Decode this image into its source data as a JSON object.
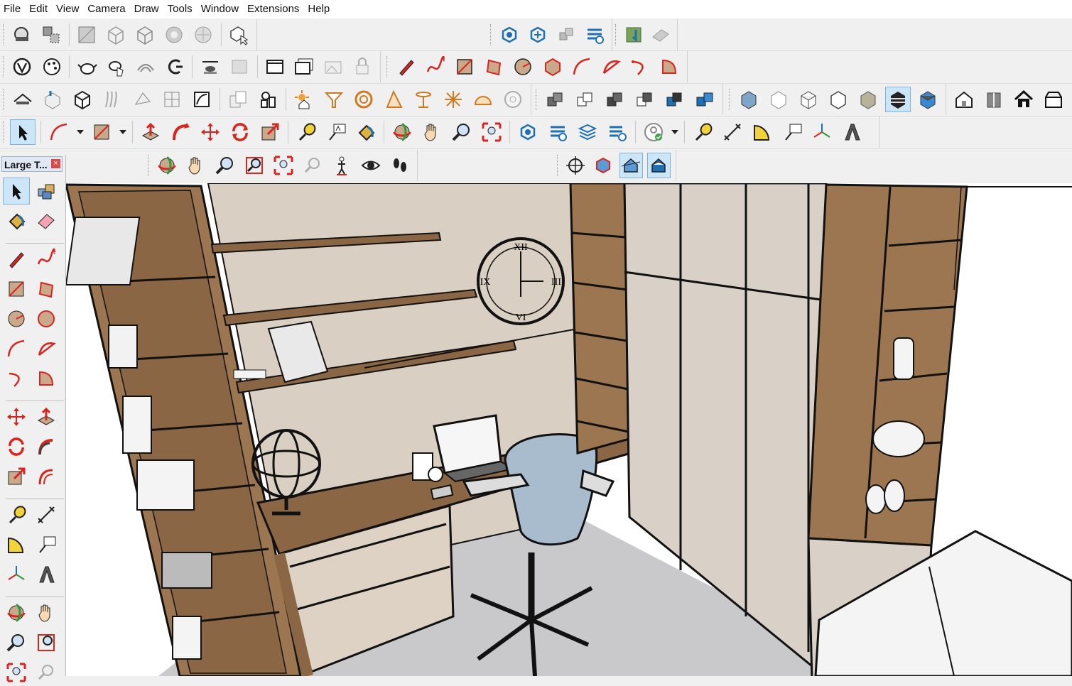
{
  "menu": [
    "File",
    "Edit",
    "View",
    "Camera",
    "Draw",
    "Tools",
    "Window",
    "Extensions",
    "Help"
  ],
  "palette": {
    "title": "Large T...",
    "close": "×"
  },
  "viewport": {
    "clock_numerals": [
      "XII",
      "III",
      "VI",
      "IX"
    ]
  },
  "colors": {
    "wood": "#9c7650",
    "wall": "#d9cfc2",
    "floor": "#c7c7c9",
    "accent_red": "#d6261f",
    "accent_blue": "#1f6fb3",
    "toolbar_bg": "#f0f0f0"
  }
}
